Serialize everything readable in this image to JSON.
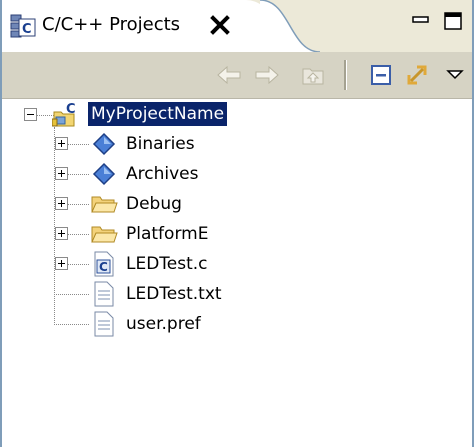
{
  "view": {
    "tab_title": "C/C++ Projects",
    "tab_icon": "cpp-projects-view-icon",
    "close_icon": "close-icon",
    "minimize_icon": "minimize-icon",
    "maximize_icon": "maximize-icon"
  },
  "toolbar": {
    "buttons": [
      {
        "icon": "back-arrow-icon",
        "enabled": false
      },
      {
        "icon": "forward-arrow-icon",
        "enabled": false
      },
      {
        "icon": "up-folder-icon",
        "enabled": false
      },
      {
        "icon": "collapse-all-icon",
        "enabled": true
      },
      {
        "icon": "link-with-editor-icon",
        "enabled": true
      },
      {
        "icon": "view-menu-icon",
        "enabled": true
      }
    ]
  },
  "tree": {
    "root": {
      "label": "MyProjectName",
      "icon": "c-project-icon",
      "expanded": true,
      "selected": true
    },
    "children": [
      {
        "label": "Binaries",
        "icon": "binaries-diamond-icon",
        "expandable": true
      },
      {
        "label": "Archives",
        "icon": "archives-diamond-icon",
        "expandable": true
      },
      {
        "label": "Debug",
        "icon": "folder-icon",
        "expandable": true
      },
      {
        "label": "PlatformE",
        "icon": "folder-icon",
        "expandable": true
      },
      {
        "label": "LEDTest.c",
        "icon": "c-source-file-icon",
        "expandable": true
      },
      {
        "label": "LEDTest.txt",
        "icon": "text-file-icon",
        "expandable": false
      },
      {
        "label": "user.pref",
        "icon": "text-file-icon",
        "expandable": false
      }
    ]
  },
  "colors": {
    "selection_bg": "#0a246a",
    "selection_fg": "#ffffff",
    "toolbar_bg": "#d6d3c4",
    "frame": "#7f9db9"
  }
}
